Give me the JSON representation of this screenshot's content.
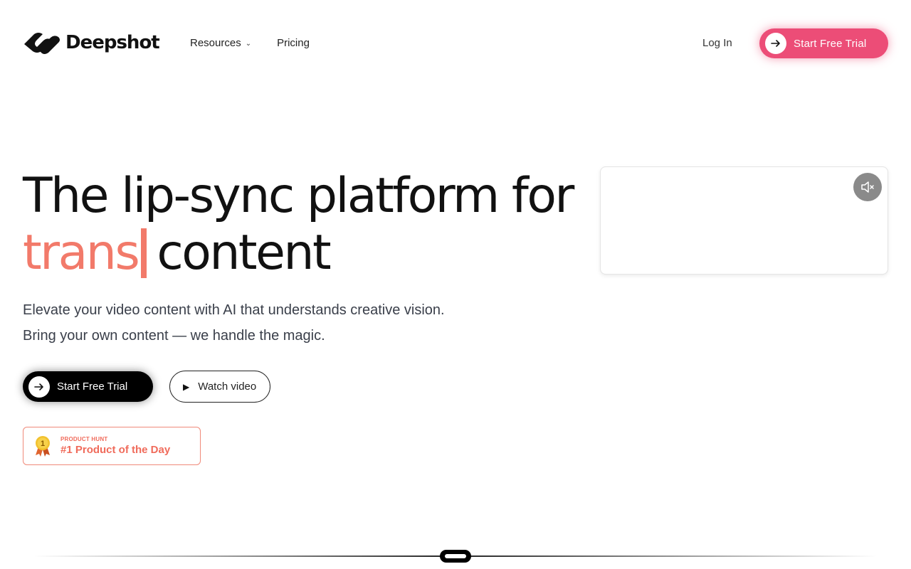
{
  "header": {
    "brand": "Deepshot",
    "nav": [
      {
        "label": "Resources",
        "has_dropdown": true,
        "icon": "chevron-down-icon"
      },
      {
        "label": "Pricing"
      }
    ],
    "login_label": "Log In",
    "cta_label": "Start Free Trial",
    "cta_color": "#ec4d77"
  },
  "hero": {
    "headline_line1": "The lip-sync platform for",
    "headline_rotating_word": "trans",
    "headline_line2_rest": "content",
    "accent_color": "#f27a6a",
    "subtext_line1": "Elevate your video content with AI that understands creative vision.",
    "subtext_line2": "Bring your own content — we handle the magic.",
    "primary_button_label": "Start Free Trial",
    "secondary_button_label": "Watch video",
    "secondary_button_icon": "play-icon"
  },
  "product_hunt": {
    "kicker": "PRODUCT HUNT",
    "title": "#1 Product of the Day",
    "medal_number": "1",
    "icon": "medal-icon"
  },
  "video": {
    "mute_icon": "speaker-muted-icon"
  }
}
